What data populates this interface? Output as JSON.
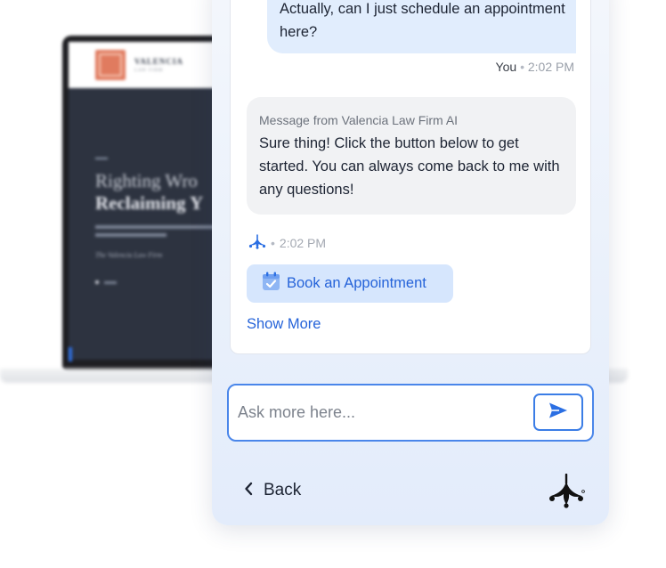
{
  "background_site": {
    "logo_name": "VALENCIA",
    "logo_sub": "LAW FIRM",
    "hero_line1": "Righting Wro",
    "hero_line2": "Reclaiming Y",
    "signature": "The Valencia Law Firm"
  },
  "chat": {
    "user_message": "Actually, can I just schedule an appointment here?",
    "user_sender": "You",
    "user_time": "2:02 PM",
    "bot_sender_label": "Message from Valencia Law Firm AI",
    "bot_message": "Sure thing! Click the button below to get started. You can always come back to me with any questions!",
    "bot_time": "2:02 PM",
    "meta_separator": "•",
    "book_button_label": "Book an Appointment",
    "book_button_icon": "calendar-check-icon",
    "show_more_label": "Show More"
  },
  "input": {
    "placeholder": "Ask more here...",
    "value": "",
    "send_icon": "send-icon"
  },
  "footer": {
    "back_label": "Back",
    "back_icon": "chevron-left-icon",
    "brand_icon": "brand-logo-icon"
  },
  "colors": {
    "accent": "#2563d9",
    "user_bubble": "#e1edfd",
    "bot_bubble": "#f1f2f4",
    "input_border": "#4a86ea"
  }
}
